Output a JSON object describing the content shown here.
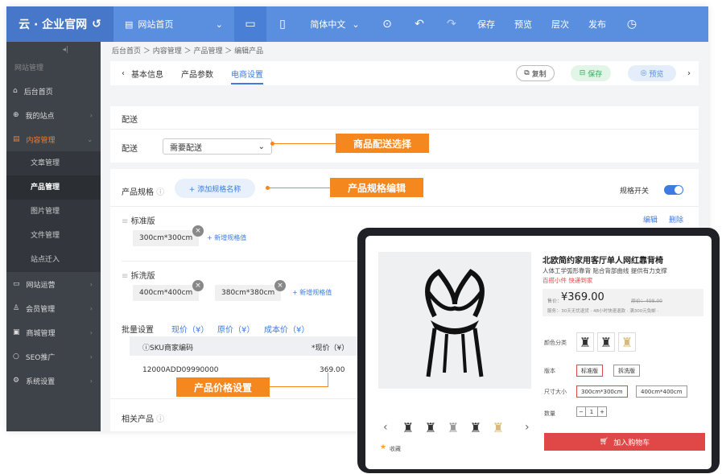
{
  "topbar": {
    "logo": "云 · 企业官网",
    "page": "网站首页",
    "lang": "简体中文",
    "buttons": [
      "保存",
      "预览",
      "层次",
      "发布"
    ],
    "color": "#5a8fe0"
  },
  "sidebar": {
    "collapse": "◂|",
    "heading": "网站管理",
    "items": [
      {
        "label": "后台首页",
        "icon": "home-icon"
      },
      {
        "label": "我的站点",
        "icon": "globe-icon"
      },
      {
        "label": "内容管理",
        "icon": "document-icon"
      }
    ],
    "sub": [
      "文章管理",
      "产品管理",
      "图片管理",
      "文件管理",
      "站点迁入"
    ],
    "items2": [
      {
        "label": "网站运营",
        "icon": "monitor-icon"
      },
      {
        "label": "会员管理",
        "icon": "users-icon"
      },
      {
        "label": "商城管理",
        "icon": "shop-icon"
      },
      {
        "label": "SEO推广",
        "icon": "search-icon"
      },
      {
        "label": "系统设置",
        "icon": "gear-icon"
      }
    ]
  },
  "main": {
    "breadcrumb": "后台首页 ＞ 内容管理 ＞ 产品管理 ＞ 编辑产品",
    "tabs": [
      "基本信息",
      "产品参数",
      "电商设置"
    ],
    "actions": {
      "copy": "复制",
      "save": "保存",
      "preview": "预览"
    },
    "delivery": {
      "section": "配送",
      "label": "配送",
      "value": "需要配送",
      "annotation": "商品配送选择"
    },
    "spec": {
      "label": "产品规格",
      "add": "+ 添加规格名称",
      "annotation": "产品规格编辑",
      "switch": "规格开关",
      "edit": "编辑",
      "delete": "删除",
      "groups": [
        {
          "name": "标准版",
          "values": [
            "300cm*300cm"
          ],
          "add": "+ 新增规格值"
        },
        {
          "name": "拆洗版",
          "values": [
            "400cm*400cm",
            "380cm*380cm"
          ],
          "add": "+ 新增规格值"
        }
      ]
    },
    "batch": {
      "label": "批量设置",
      "links": [
        "现价（¥）",
        "原价（¥）",
        "成本价（¥）"
      ]
    },
    "table": {
      "headers": [
        "ⓘSKU商家编码",
        "*现价（¥）"
      ],
      "rows": [
        [
          "12000ADD09990000",
          "369.00"
        ]
      ]
    },
    "price_annotation": "产品价格设置",
    "related": "相关产品"
  },
  "preview": {
    "title": "北欧简约家用客厅单人网红靠背椅",
    "subtitle": "人体工学弧形靠背 贴合背部曲线 提供有力支撑",
    "promo": "百搭小件 快递到家",
    "price_label": "售价：",
    "price": "¥369.00",
    "old_price": "原价：498.00",
    "service": "服务：· 30天无忧退货 · 48小时快速退款 · 满300元免邮 ·",
    "color_label": "颜色分类",
    "version_label": "版本",
    "versions": [
      "标准版",
      "拆洗版"
    ],
    "size_label": "尺寸大小",
    "sizes": [
      "300cm*300cm",
      "400cm*400cm"
    ],
    "qty_label": "数量",
    "qty": "1",
    "cart": "加入购物车",
    "fav": "收藏",
    "cart_color": "#e04848"
  }
}
